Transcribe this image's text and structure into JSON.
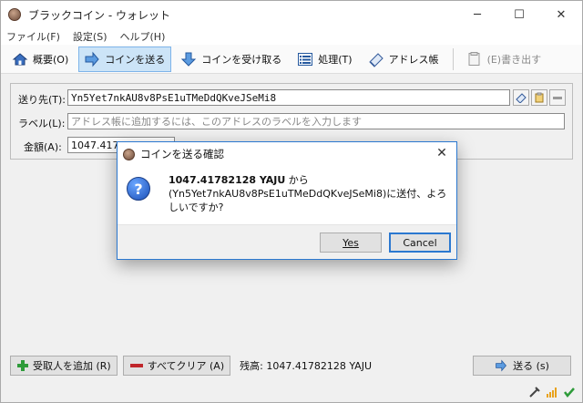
{
  "window": {
    "title": "ブラックコイン - ウォレット",
    "controls": {
      "minimize": "─",
      "maximize": "☐",
      "close": "✕"
    }
  },
  "menubar": {
    "items": [
      "ファイル(F)",
      "設定(S)",
      "ヘルプ(H)"
    ]
  },
  "toolbar": {
    "overview": "概要(O)",
    "send": "コインを送る",
    "receive": "コインを受け取る",
    "transactions": "処理(T)",
    "addressbook": "アドレス帳",
    "export": "(E)書き出す"
  },
  "form": {
    "pay_to_label": "送り先(T):",
    "pay_to_value": "Yn5Yet7nkAU8v8PsE1uTMeDdQKveJSeMi8",
    "label_label": "ラベル(L):",
    "label_placeholder": "アドレス帳に追加するには、このアドレスのラベルを入力します",
    "amount_label": "金額(A):",
    "amount_value": "1047.41782128"
  },
  "bottom": {
    "add_recipient": "受取人を追加 (R)",
    "clear_all": "すべてクリア (A)",
    "balance": "残高: 1047.41782128 YAJU",
    "send": "送る (s)"
  },
  "dialog": {
    "title": "コインを送る確認",
    "amount": "1047.41782128 YAJU",
    "from_text": " から",
    "message": "(Yn5Yet7nkAU8v8PsE1uTMeDdQKveJSeMi8)に送付、よろしいですか?",
    "yes": "Yes",
    "cancel": "Cancel",
    "close": "✕"
  },
  "colors": {
    "accent": "#2b78d0",
    "active_tab_bg": "#cce4f7",
    "question_icon": "#1a4fb8"
  }
}
